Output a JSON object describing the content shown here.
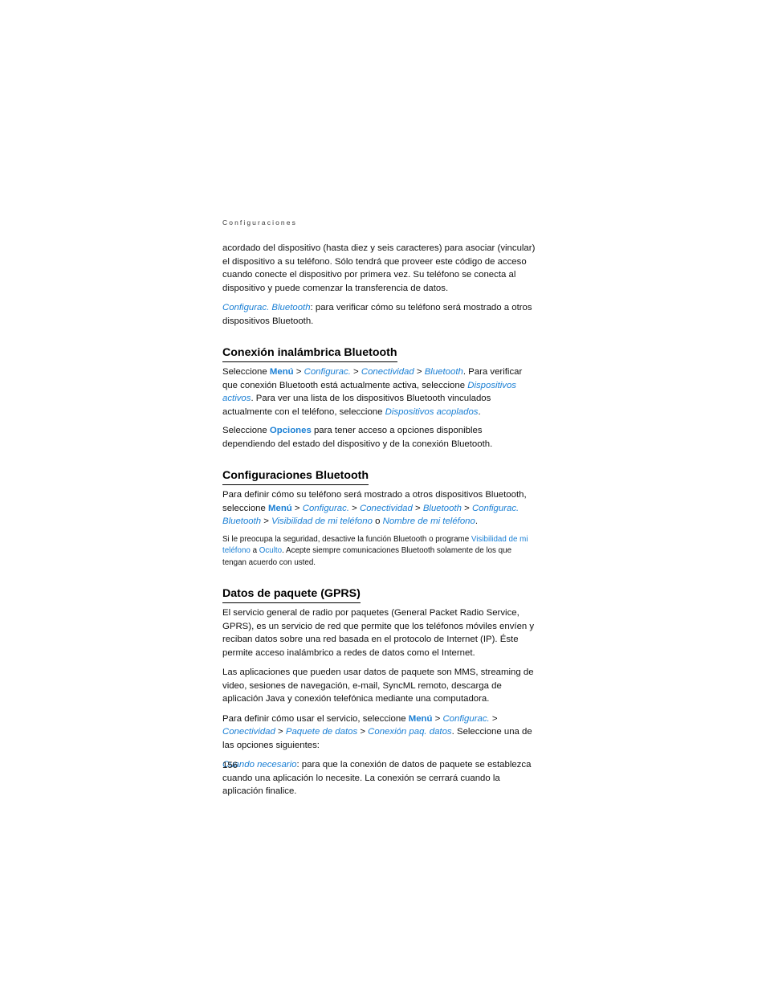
{
  "header": {
    "running_title": "Configuraciones"
  },
  "page_number": "156",
  "colors": {
    "ui_term_blue": "#1a7fd4",
    "body_text": "#111111",
    "header_gray": "#3a3a3a",
    "page_background": "#ffffff"
  },
  "content": {
    "intro_paragraph": "acordado del dispositivo (hasta diez y seis caracteres) para asociar (vincular) el dispositivo a su teléfono. Sólo tendrá que proveer este código de acceso cuando conecte el dispositivo por primera vez. Su teléfono se conecta al dispositivo y puede comenzar la transferencia de datos.",
    "bluetooth_config_term": "Configurac. Bluetooth",
    "bluetooth_config_desc": ": para verificar cómo su teléfono será mostrado a otros dispositivos Bluetooth.",
    "heading_conexion": "Conexión inalámbrica Bluetooth",
    "conexion_p1_a": "Seleccione ",
    "conexion_menu": "Menú",
    "conexion_sep1": " > ",
    "conexion_configurac": "Configurac.",
    "conexion_sep2": " > ",
    "conexion_conectividad": "Conectividad",
    "conexion_sep3": " > ",
    "conexion_bluetooth": "Bluetooth",
    "conexion_p1_b": ". Para verificar que conexión Bluetooth está actualmente activa, seleccione ",
    "conexion_dispositivos_activos": "Dispositivos activos",
    "conexion_p1_c": ". Para ver una lista de los dispositivos Bluetooth vinculados actualmente con el teléfono, seleccione ",
    "conexion_dispositivos_acoplados": "Dispositivos acoplados",
    "conexion_p1_d": ".",
    "conexion_p2_a": "Seleccione ",
    "conexion_opciones": "Opciones",
    "conexion_p2_b": " para tener acceso a opciones disponibles dependiendo del estado del dispositivo y de la conexión Bluetooth.",
    "heading_config_bt": "Configuraciones Bluetooth",
    "config_p1_a": "Para definir cómo su teléfono será mostrado a otros dispositivos Bluetooth, seleccione ",
    "config_menu": "Menú",
    "config_sep1": " > ",
    "config_configurac": "Configurac.",
    "config_sep2": " > ",
    "config_conectividad": "Conectividad",
    "config_sep3": " > ",
    "config_bluetooth": "Bluetooth",
    "config_sep4": " > ",
    "config_configurac_bluetooth": "Configurac. Bluetooth",
    "config_sep5": " > ",
    "config_visibilidad": "Visibilidad de mi teléfono",
    "config_o": " o ",
    "config_nombre": "Nombre de mi teléfono",
    "config_p1_end": ".",
    "note_a": "Si le preocupa la seguridad, desactive la función Bluetooth o programe ",
    "note_visibilidad": "Visibilidad de mi teléfono",
    "note_b": " a ",
    "note_oculto": "Oculto",
    "note_c": ". Acepte siempre comunicaciones Bluetooth solamente de los que tengan acuerdo con usted.",
    "heading_gprs": "Datos de paquete (GPRS)",
    "gprs_p1": "El servicio general de radio por paquetes (General Packet Radio Service, GPRS), es un servicio de red que permite que los teléfonos móviles envíen y reciban datos sobre una red basada en el protocolo de Internet (IP). Éste permite acceso inalámbrico a redes de datos como el Internet.",
    "gprs_p2": "Las aplicaciones que pueden usar datos de paquete son MMS, streaming de video, sesiones de navegación, e-mail, SyncML remoto, descarga de aplicación Java y conexión telefónica mediante una computadora.",
    "gprs_p3_a": "Para definir cómo usar el servicio, seleccione ",
    "gprs_menu": "Menú",
    "gprs_sep1": " > ",
    "gprs_configurac": "Configurac.",
    "gprs_sep2": " > ",
    "gprs_conectividad": "Conectividad",
    "gprs_sep3": " > ",
    "gprs_paquete_datos": "Paquete de datos",
    "gprs_sep4": " > ",
    "gprs_conexion_paq": "Conexión paq. datos",
    "gprs_p3_b": ". Seleccione una de las opciones siguientes:",
    "cuando_necesario": "Cuando necesario",
    "cuando_necesario_desc": ": para que la conexión de datos de paquete se establezca cuando una aplicación lo necesite. La conexión se cerrará cuando la aplicación finalice."
  }
}
